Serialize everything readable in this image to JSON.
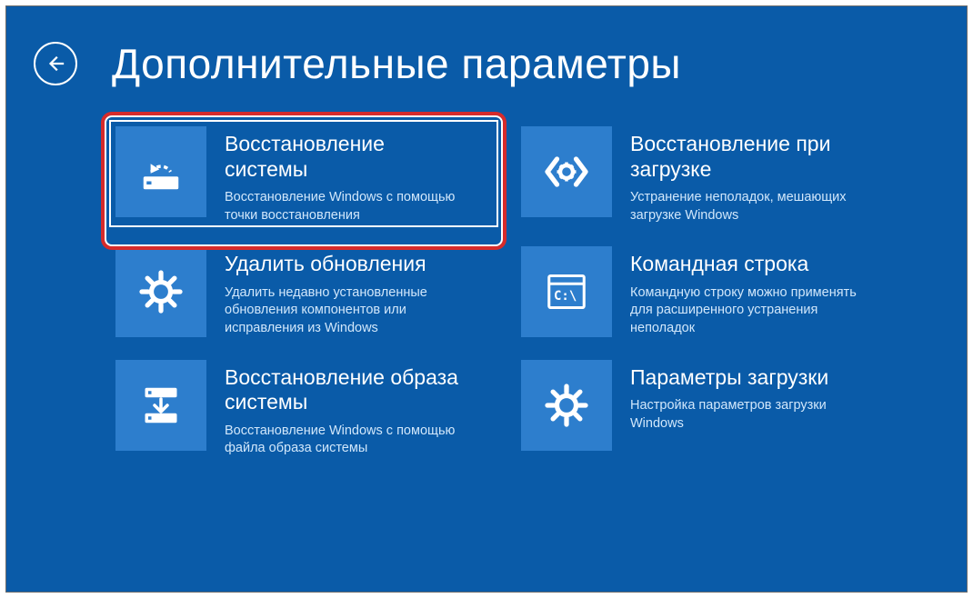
{
  "page": {
    "title": "Дополнительные параметры"
  },
  "tiles": [
    {
      "title": "Восстановление системы",
      "desc": "Восстановление Windows с помощью точки восстановления"
    },
    {
      "title": "Восстановление при загрузке",
      "desc": "Устранение неполадок, мешающих загрузке Windows"
    },
    {
      "title": "Удалить обновления",
      "desc": "Удалить недавно установленные обновления компонентов или исправления из Windows"
    },
    {
      "title": "Командная строка",
      "desc": "Командную строку можно применять для расширенного устранения неполадок"
    },
    {
      "title": "Восстановление образа системы",
      "desc": "Восстановление Windows с помощью файла образа системы"
    },
    {
      "title": "Параметры загрузки",
      "desc": "Настройка параметров загрузки Windows"
    }
  ]
}
